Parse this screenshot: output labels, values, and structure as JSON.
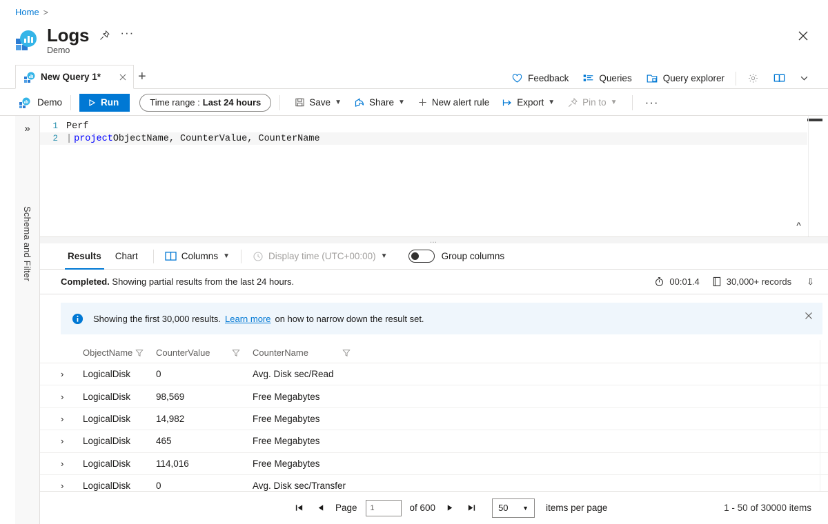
{
  "breadcrumb": {
    "items": [
      "Home"
    ]
  },
  "header": {
    "title": "Logs",
    "subtitle": "Demo",
    "icon": "logs-icon",
    "pin_icon": "pin-icon",
    "more_icon": "ellipsis-icon",
    "close_icon": "close-icon"
  },
  "tabs": {
    "items": [
      {
        "label": "New Query 1*",
        "icon": "query-icon",
        "close_icon": "close-icon",
        "active": true
      }
    ],
    "add_label": "+"
  },
  "top_actions": [
    {
      "label": "Feedback",
      "icon": "heart-icon"
    },
    {
      "label": "Queries",
      "icon": "list-icon"
    },
    {
      "label": "Query explorer",
      "icon": "explorer-icon"
    }
  ],
  "top_icons": [
    {
      "name": "settings-gear-icon"
    },
    {
      "name": "book-icon"
    },
    {
      "name": "chevron-down-icon"
    }
  ],
  "command_bar": {
    "scope": "Demo",
    "scope_icon": "workspace-icon",
    "run_label": "Run",
    "run_icon": "play-icon",
    "time_range_prefix": "Time range :",
    "time_range_value": "Last 24 hours",
    "buttons": [
      {
        "label": "Save",
        "icon": "save-icon",
        "has_chevron": true,
        "dim": false
      },
      {
        "label": "Share",
        "icon": "share-icon",
        "has_chevron": true,
        "dim": false
      },
      {
        "label": "New alert rule",
        "icon": "plus-icon",
        "has_chevron": false,
        "dim": false
      },
      {
        "label": "Export",
        "icon": "export-icon",
        "has_chevron": true,
        "dim": false
      },
      {
        "label": "Pin to",
        "icon": "pin-icon",
        "has_chevron": true,
        "dim": true
      }
    ],
    "more_label": "···"
  },
  "left_rail": {
    "expand_icon": "double-chevron-right-icon",
    "label": "Schema and Filter"
  },
  "editor": {
    "lines": [
      {
        "number": "1",
        "tokens": [
          {
            "text": "Perf",
            "type": "plain"
          }
        ]
      },
      {
        "number": "2",
        "tokens": [
          {
            "text": "|",
            "type": "pipe"
          },
          {
            "text": "project",
            "type": "keyword"
          },
          {
            "text": " ObjectName, CounterValue, CounterName",
            "type": "plain"
          }
        ]
      }
    ],
    "collapse_icon": "double-chevron-up-icon"
  },
  "results": {
    "tabs": [
      {
        "label": "Results",
        "active": true
      },
      {
        "label": "Chart",
        "active": false
      }
    ],
    "columns_button": {
      "label": "Columns",
      "icon": "columns-icon",
      "has_chevron": true
    },
    "display_time_button": {
      "label": "Display time (UTC+00:00)",
      "icon": "clock-icon",
      "has_chevron": true,
      "disabled": true
    },
    "group_columns": {
      "label": "Group columns",
      "on": false
    },
    "status": {
      "state": "Completed.",
      "message": " Showing partial results from the last 24 hours.",
      "duration": "00:01.4",
      "duration_icon": "timer-icon",
      "records": "30,000+ records",
      "records_icon": "records-icon",
      "expand_icon": "double-chevron-down-icon"
    },
    "info_banner": {
      "icon": "info-icon",
      "text_before": "Showing the first 30,000 results.",
      "link_text": "Learn more",
      "text_after": "on how to narrow down the result set.",
      "close_icon": "close-icon"
    },
    "table": {
      "columns": [
        {
          "label": "ObjectName",
          "filter_icon": "filter-icon"
        },
        {
          "label": "CounterValue",
          "filter_icon": "filter-icon"
        },
        {
          "label": "CounterName",
          "filter_icon": "filter-icon"
        }
      ],
      "expand_icon": "chevron-right-icon",
      "rows": [
        {
          "ObjectName": "LogicalDisk",
          "CounterValue": "0",
          "CounterName": "Avg. Disk sec/Read"
        },
        {
          "ObjectName": "LogicalDisk",
          "CounterValue": "98,569",
          "CounterName": "Free Megabytes"
        },
        {
          "ObjectName": "LogicalDisk",
          "CounterValue": "14,982",
          "CounterName": "Free Megabytes"
        },
        {
          "ObjectName": "LogicalDisk",
          "CounterValue": "465",
          "CounterName": "Free Megabytes"
        },
        {
          "ObjectName": "LogicalDisk",
          "CounterValue": "114,016",
          "CounterName": "Free Megabytes"
        },
        {
          "ObjectName": "LogicalDisk",
          "CounterValue": "0",
          "CounterName": "Avg. Disk sec/Transfer"
        }
      ]
    },
    "pager": {
      "first_icon": "first-page-icon",
      "prev_icon": "previous-page-icon",
      "page_label": "Page",
      "page_value": "1",
      "of_label": "of 600",
      "next_icon": "next-page-icon",
      "last_icon": "last-page-icon",
      "page_size": "50",
      "page_size_label": "items per page",
      "range_text": "1 - 50 of 30000 items"
    }
  },
  "colors": {
    "accent": "#0078d4",
    "info_bg": "#eff6fc",
    "keyword": "#0000ff",
    "line_number": "#2b91af",
    "border": "#e1dfdd"
  }
}
